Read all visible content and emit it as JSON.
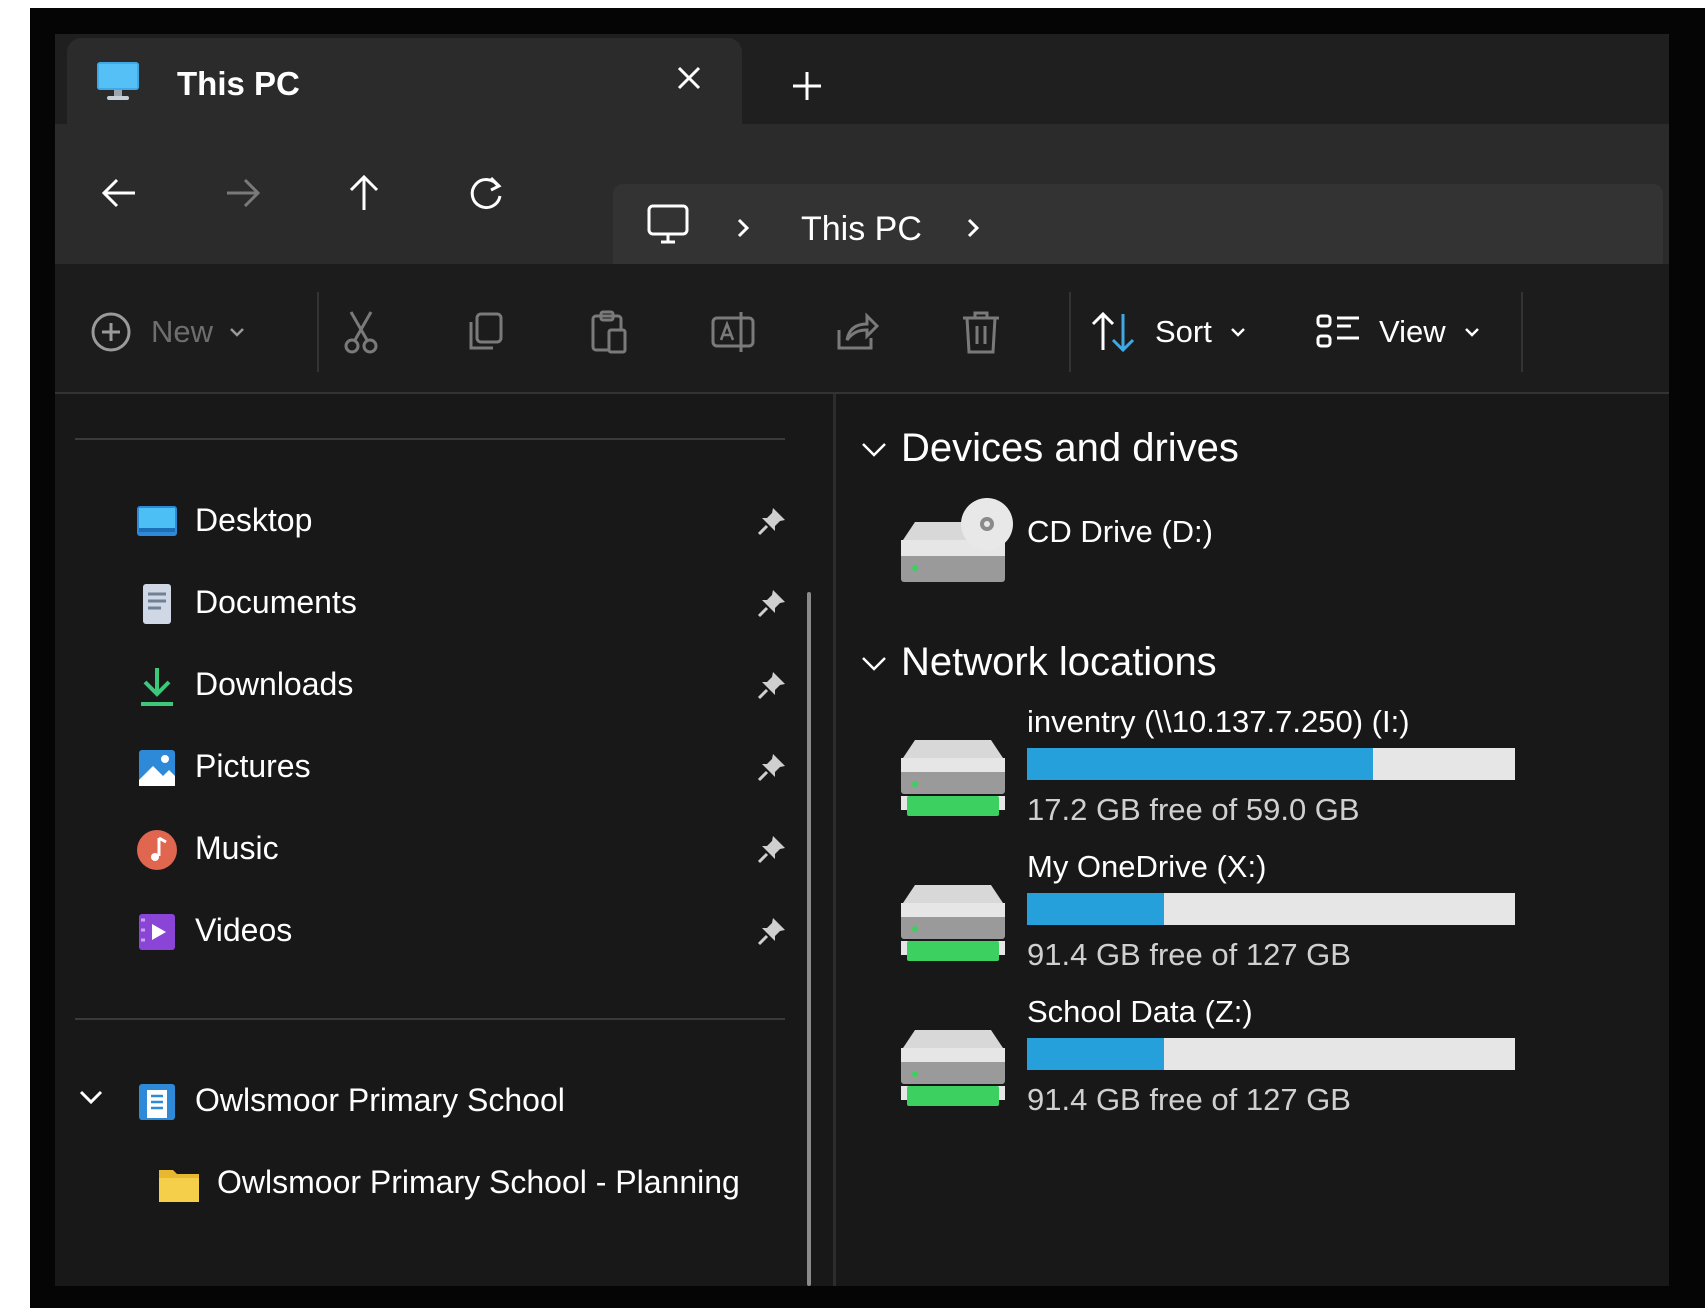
{
  "tab": {
    "title": "This PC",
    "icon": "monitor-icon"
  },
  "nav": {
    "back": "back-arrow-icon",
    "forward": "forward-arrow-icon",
    "up": "up-arrow-icon",
    "refresh": "refresh-icon",
    "breadcrumb": [
      "This PC"
    ]
  },
  "toolbar": {
    "new_label": "New",
    "sort_label": "Sort",
    "view_label": "View"
  },
  "sidebar": {
    "quick_access": [
      {
        "label": "Desktop",
        "icon": "desktop-folder-icon"
      },
      {
        "label": "Documents",
        "icon": "documents-folder-icon"
      },
      {
        "label": "Downloads",
        "icon": "downloads-folder-icon"
      },
      {
        "label": "Pictures",
        "icon": "pictures-folder-icon"
      },
      {
        "label": "Music",
        "icon": "music-folder-icon"
      },
      {
        "label": "Videos",
        "icon": "videos-folder-icon"
      }
    ],
    "org": {
      "label": "Owlsmoor Primary School",
      "child": "Owlsmoor Primary School - Planning"
    }
  },
  "main": {
    "devices_heading": "Devices and drives",
    "cd_drive": "CD Drive (D:)",
    "network_heading": "Network locations",
    "network_drives": [
      {
        "name": "inventry (\\\\10.137.7.250) (I:)",
        "free": "17.2 GB free of 59.0 GB",
        "used_fraction": 0.708
      },
      {
        "name": "My OneDrive (X:)",
        "free": "91.4 GB free of 127 GB",
        "used_fraction": 0.28
      },
      {
        "name": "School Data (Z:)",
        "free": "91.4 GB free of 127 GB",
        "used_fraction": 0.28
      }
    ]
  },
  "colors": {
    "bar_fill": "#26a0da",
    "bar_track": "#e6e6e6",
    "background": "#181818"
  }
}
